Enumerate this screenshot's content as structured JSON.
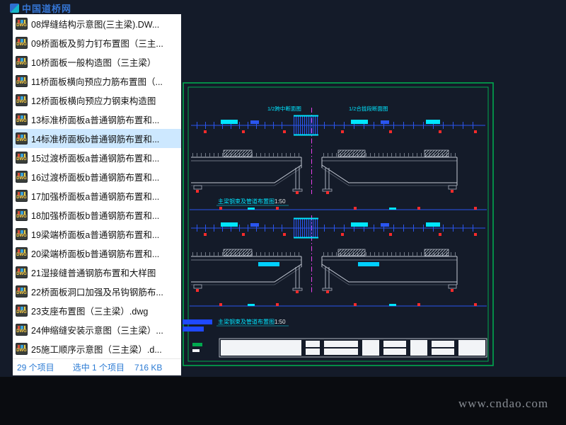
{
  "watermarks": {
    "top_left": "中国道桥网",
    "bottom_right": "www.cndao.com"
  },
  "file_panel": {
    "icon_label": "DWG",
    "items": [
      {
        "label": "08焊缝结构示意图(三主梁).DW...",
        "selected": false
      },
      {
        "label": "09桥面板及剪力钉布置图（三主...",
        "selected": false
      },
      {
        "label": "10桥面板一般构造图（三主梁）",
        "selected": false
      },
      {
        "label": "11桥面板横向预应力筋布置图（...",
        "selected": false
      },
      {
        "label": "12桥面板横向预应力钢束构造图",
        "selected": false
      },
      {
        "label": "13标准桥面板a普通钢筋布置和...",
        "selected": false
      },
      {
        "label": "14标准桥面板b普通钢筋布置和...",
        "selected": true
      },
      {
        "label": "15过渡桥面板a普通钢筋布置和...",
        "selected": false
      },
      {
        "label": "16过渡桥面板b普通钢筋布置和...",
        "selected": false
      },
      {
        "label": "17加强桥面板a普通钢筋布置和...",
        "selected": false
      },
      {
        "label": "18加强桥面板b普通钢筋布置和...",
        "selected": false
      },
      {
        "label": "19梁端桥面板a普通钢筋布置和...",
        "selected": false
      },
      {
        "label": "20梁端桥面板b普通钢筋布置和...",
        "selected": false
      },
      {
        "label": "21湿接缝普通钢筋布置和大样图",
        "selected": false
      },
      {
        "label": "22桥面板洞口加强及吊钩钢筋布...",
        "selected": false
      },
      {
        "label": "23支座布置图（三主梁）.dwg",
        "selected": false
      },
      {
        "label": "24伸缩缝安装示意图（三主梁）...",
        "selected": false
      },
      {
        "label": "25施工顺序示意图（三主梁）.d...",
        "selected": false
      }
    ]
  },
  "status_bar": {
    "total": "29 个项目",
    "selected": "选中 1 个项目",
    "size": "716 KB"
  },
  "drawing": {
    "section_label_left": "1/2跨中断面图",
    "section_label_right": "1/2合拢段断面图",
    "caption_top": "主梁钢束及管道布置图",
    "caption_top_scale": "1:50",
    "caption_bottom": "主梁钢束及管道布置图",
    "caption_bottom_scale": "1:50"
  },
  "colors": {
    "frame_green": "#00a94f",
    "cad_blue": "#2a55f0",
    "cad_cyan": "#00e5ff",
    "cad_red": "#ff2b2b",
    "cad_magenta": "#ff44ff",
    "selection_bg": "#cde8ff",
    "status_text": "#2b7bd4"
  }
}
